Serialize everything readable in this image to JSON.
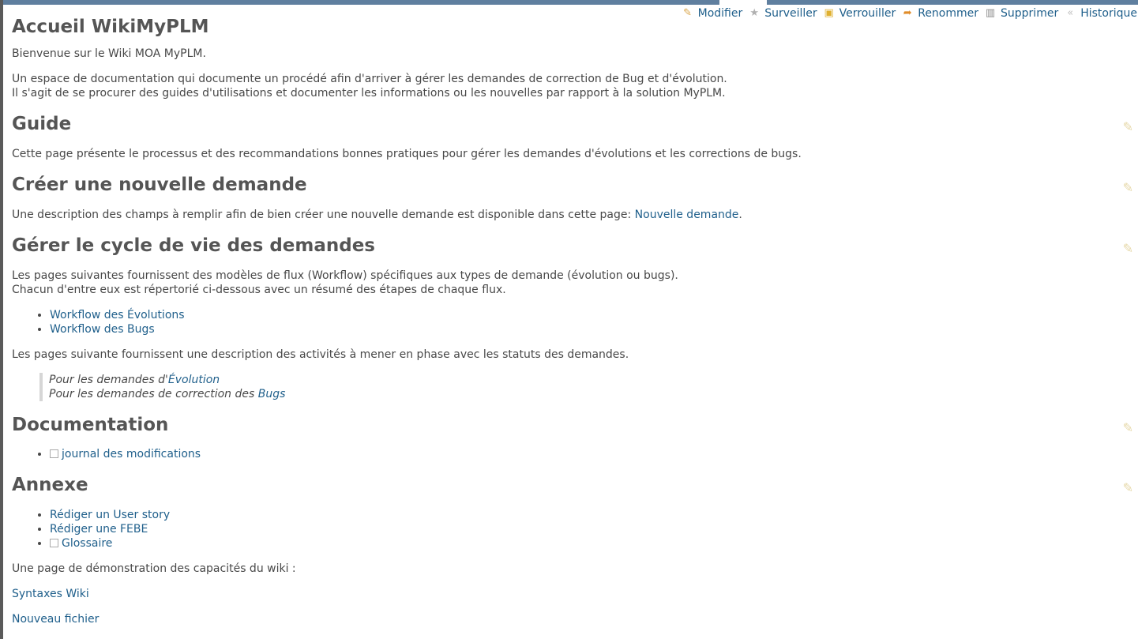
{
  "title": "Accueil WikiMyPLM",
  "actions": [
    {
      "label": "Modifier",
      "icon": "pencil-icon",
      "glyph": "✎",
      "color": "#d9a54a"
    },
    {
      "label": "Surveiller",
      "icon": "star-icon",
      "glyph": "★",
      "color": "#b0b0b0"
    },
    {
      "label": "Verrouiller",
      "icon": "lock-icon",
      "glyph": "🔒",
      "color": "#e0b030"
    },
    {
      "label": "Renommer",
      "icon": "rename-arrow-icon",
      "glyph": "➦",
      "color": "#e08c2a"
    },
    {
      "label": "Supprimer",
      "icon": "trash-icon",
      "glyph": "🗑",
      "color": "#888888"
    },
    {
      "label": "Historique",
      "icon": "history-icon",
      "glyph": "«",
      "color": "#c0c0c0"
    }
  ],
  "intro": {
    "welcome": "Bienvenue sur le Wiki MOA MyPLM.",
    "line1": "Un espace de documentation qui documente un procédé afin d'arriver à gérer les demandes de correction de Bug et d'évolution.",
    "line2": "Il s'agit de se procurer des guides d'utilisations et documenter les informations ou les nouvelles par rapport à la solution MyPLM."
  },
  "guide": {
    "heading": "Guide",
    "text": "Cette page présente le processus et des recommandations bonnes pratiques pour gérer les demandes d'évolutions et les corrections de bugs."
  },
  "creer": {
    "heading": "Créer une nouvelle demande",
    "text": "Une description des champs à remplir afin de bien créer une nouvelle demande est disponible dans cette page: ",
    "link": "Nouvelle demande",
    "suffix": "."
  },
  "cycle": {
    "heading": "Gérer le cycle de vie des demandes",
    "line1": "Les pages suivantes fournissent des modèles de flux (Workflow) spécifiques aux types de demande (évolution ou bugs).",
    "line2": "Chacun d'entre eux est répertorié ci-dessous avec un résumé des étapes de chaque flux.",
    "links": [
      "Workflow des Évolutions",
      "Workflow des Bugs"
    ],
    "text2": "Les pages suivante fournissent une description des activités à mener en phase avec les statuts des demandes.",
    "quote1_prefix": "Pour les demandes d'",
    "quote1_link": "Évolution",
    "quote2_prefix": "Pour les demandes de correction des ",
    "quote2_link": "Bugs"
  },
  "documentation": {
    "heading": "Documentation",
    "link": "journal des modifications"
  },
  "annexe": {
    "heading": "Annexe",
    "links": [
      "Rédiger un User story",
      "Rédiger une FEBE",
      "Glossaire"
    ],
    "text": "Une page de démonstration des capacités du wiki :",
    "link_syntax": "Syntaxes Wiki",
    "link_new_file": "Nouveau fichier"
  }
}
